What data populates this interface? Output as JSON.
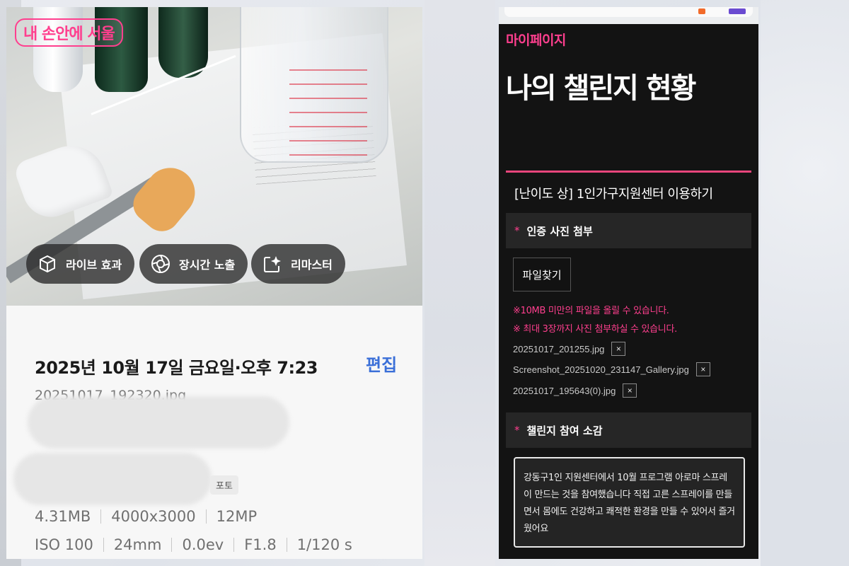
{
  "left_screen": {
    "brand_logo": "내 손안에 서울",
    "chips": [
      {
        "label": "라이브 효과",
        "icon": "live-effect-icon"
      },
      {
        "label": "장시간 노출",
        "icon": "long-exposure-icon"
      },
      {
        "label": "리마스터",
        "icon": "remaster-icon"
      }
    ],
    "date": "2025년 10월 17일 금요일·오후 7:23",
    "edit_label": "편집",
    "filename": "20251017_192320.jpg",
    "badge": "포토",
    "specs_row1": [
      "4.31MB",
      "4000x3000",
      "12MP"
    ],
    "specs_row2": [
      "ISO 100",
      "24mm",
      "0.0ev",
      "F1.8",
      "1/120 s"
    ]
  },
  "right_screen": {
    "mypage_label": "마이페이지",
    "page_heading": "나의 챌린지 현황",
    "challenge_title": "[난이도 상] 1인가구지원센터 이용하기",
    "photo_section": {
      "required_mark": "*",
      "label": "인증 사진 첨부",
      "file_button": "파일찾기",
      "notices": [
        "※10MB 미만의 파일을 올릴 수 있습니다.",
        "※ 최대 3장까지 사진 첨부하실 수 있습니다."
      ],
      "files": [
        "20251017_201255.jpg",
        "Screenshot_20251020_231147_Gallery.jpg",
        "20251017_195643(0).jpg"
      ],
      "remove_symbol": "×"
    },
    "feedback_section": {
      "required_mark": "*",
      "label": "챌린지 참여 소감",
      "text": "강동구1인 지원센터에서 10월 프로그램 아로마 스프레이 만드는 것을 참여했습니다 직접 고른 스프레이를 만들면서 몸에도 건강하고 쾌적한 환경을 만들 수 있어서 즐거웠어요"
    }
  },
  "colors": {
    "brand_pink": "#ff3f8e",
    "edit_blue": "#3a6fd8",
    "dark_bg": "#131313",
    "section_bg": "#262626"
  }
}
